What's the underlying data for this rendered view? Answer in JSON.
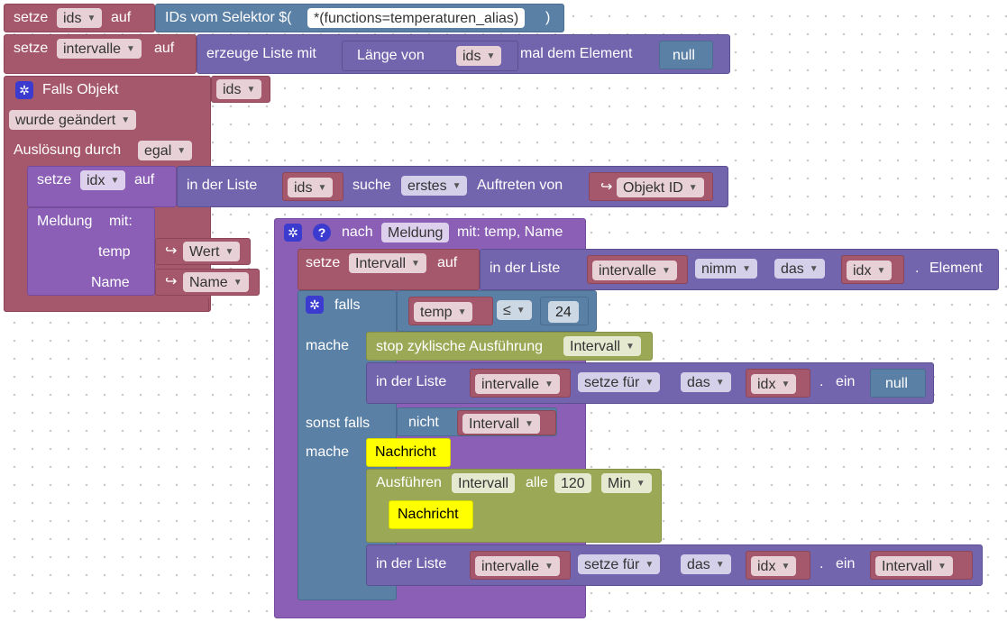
{
  "b1": {
    "set": "setze",
    "var": "ids",
    "to": "auf",
    "selector": "IDs vom Selektor $(",
    "pattern": "*(functions=temperaturen_alias)",
    "close": ")"
  },
  "b2": {
    "set": "setze",
    "var": "intervalle",
    "to": "auf",
    "create": "erzeuge Liste mit",
    "length": "Länge von",
    "lenvar": "ids",
    "times": "mal dem Element",
    "null": "null"
  },
  "b3": {
    "if_object": "Falls Objekt",
    "var": "ids",
    "changed": "wurde geändert",
    "trigger": "Auslösung durch",
    "any": "egal"
  },
  "b4": {
    "set": "setze",
    "var": "idx",
    "to": "auf",
    "inlist": "in der Liste",
    "list": "ids",
    "search": "suche",
    "first": "erstes",
    "occurrence": "Auftreten von",
    "objid": "Objekt ID",
    "return_icon": "↪"
  },
  "b5": {
    "message": "Meldung",
    "with": "mit:",
    "p1": "temp",
    "v1": "Wert",
    "p2": "Name",
    "v2": "Name"
  },
  "fn": {
    "to": "nach",
    "name": "Meldung",
    "params": "mit: temp, Name"
  },
  "fn_set": {
    "set": "setze",
    "var": "Intervall",
    "to": "auf",
    "inlist": "in der Liste",
    "list": "intervalle",
    "take": "nimm",
    "the": "das",
    "idx": "idx",
    "element": "Element"
  },
  "iff": {
    "if": "falls",
    "left": "temp",
    "op": "≤",
    "right": "24",
    "do": "mache",
    "elseif": "sonst falls",
    "not": "nicht",
    "notvar": "Intervall",
    "do2": "mache"
  },
  "stop": {
    "label": "stop zyklische Ausführung",
    "var": "Intervall"
  },
  "set1": {
    "inlist": "in der Liste",
    "list": "intervalle",
    "setfor": "setze für",
    "the": "das",
    "idx": "idx",
    "in": "ein",
    "val": "null"
  },
  "msg1": {
    "label": "Nachricht"
  },
  "exec": {
    "label": "Ausführen",
    "var": "Intervall",
    "every": "alle",
    "n": "120",
    "unit": "Min"
  },
  "msg2": {
    "label": "Nachricht"
  },
  "set2": {
    "inlist": "in der Liste",
    "list": "intervalle",
    "setfor": "setze für",
    "the": "das",
    "idx": "idx",
    "in": "ein",
    "val": "Intervall"
  },
  "icons": {
    "dropdown": "▼",
    "gear": "✲",
    "help": "?"
  }
}
